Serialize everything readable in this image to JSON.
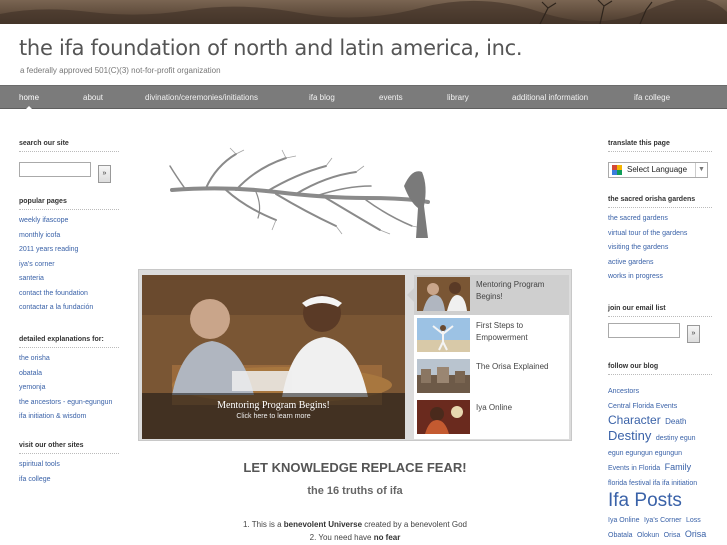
{
  "site": {
    "title": "the ifa foundation of north and latin america, inc.",
    "tagline": "a federally approved 501(C)(3) not-for-profit organization"
  },
  "nav": [
    {
      "label": "home",
      "active": true
    },
    {
      "label": "about"
    },
    {
      "label": "divination/ceremonies/initiations"
    },
    {
      "label": "ifa blog"
    },
    {
      "label": "events"
    },
    {
      "label": "library"
    },
    {
      "label": "additional information"
    },
    {
      "label": "ifa college"
    }
  ],
  "left": {
    "search": {
      "heading": "search our site",
      "button": "»"
    },
    "popular": {
      "heading": "popular pages",
      "links": [
        "weekly ifascope",
        "monthly icofa",
        "2011 years reading",
        "iya's corner",
        "santeria",
        "contact the foundation",
        "contactar a la fundación"
      ]
    },
    "detailed": {
      "heading": "detailed explanations for:",
      "links": [
        "the orisha",
        "obatala",
        "yemonja",
        "the ancestors - egun-egungun",
        "ifa initiation & wisdom"
      ]
    },
    "other": {
      "heading": "visit our other sites",
      "links": [
        "spiritual tools",
        "ifa college"
      ]
    }
  },
  "slider": {
    "caption_title": "Mentoring Program Begins!",
    "caption_sub": "Click here to learn more",
    "items": [
      {
        "label": "Mentoring Program Begins!",
        "active": true
      },
      {
        "label": "First Steps to Empowerment"
      },
      {
        "label": "The Orisa Explained"
      },
      {
        "label": "Iya Online"
      }
    ]
  },
  "main": {
    "motto": "LET KNOWLEDGE REPLACE FEAR!",
    "motto_sub": "the 16 truths of ifa",
    "truth1": {
      "pre": "1. This is a ",
      "bold": "benevolent Universe",
      "post": " created by a benevolent God"
    },
    "truth2": {
      "pre": "2. You need have ",
      "bold": "no fear",
      "post": ""
    }
  },
  "right": {
    "translate": {
      "heading": "translate this page",
      "select_value": "Select Language"
    },
    "gardens": {
      "heading": "the sacred orisha gardens",
      "links": [
        "the sacred gardens",
        "virtual tour of the gardens",
        "visiting the gardens",
        "active gardens",
        "works in progress"
      ]
    },
    "email": {
      "heading": "join our email list",
      "button": "»"
    },
    "blog": {
      "heading": "follow our blog",
      "tags": [
        {
          "t": "Ancestors",
          "s": 7
        },
        {
          "t": "Central Florida Events",
          "s": 7
        },
        {
          "t": "Character",
          "s": 12
        },
        {
          "t": "Death",
          "s": 8
        },
        {
          "t": "Destiny",
          "s": 13
        },
        {
          "t": "destiny egun",
          "s": 7
        },
        {
          "t": "egun egungun egungun",
          "s": 7
        },
        {
          "t": "Events in Florida",
          "s": 7
        },
        {
          "t": "Family",
          "s": 9
        },
        {
          "t": "florida festival ifa ifa initiation",
          "s": 7
        },
        {
          "t": "Ifa Posts",
          "s": 19
        },
        {
          "t": "Iya Online",
          "s": 7
        },
        {
          "t": "Iya's Corner",
          "s": 7
        },
        {
          "t": "Loss",
          "s": 7
        },
        {
          "t": "Obatala",
          "s": 7
        },
        {
          "t": "Olokun",
          "s": 7
        },
        {
          "t": "Orisa",
          "s": 7
        },
        {
          "t": "Orisa",
          "s": 9
        }
      ]
    }
  },
  "colors": {
    "link": "#3a62a8",
    "nav_bg": "#7b7b7b",
    "banner": "#5e4b3b"
  }
}
